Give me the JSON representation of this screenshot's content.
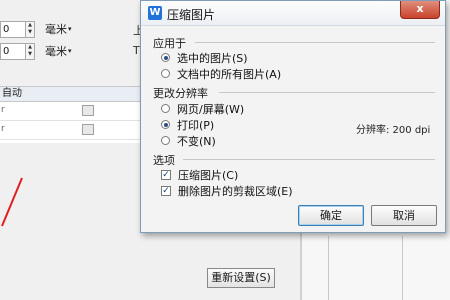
{
  "background": {
    "spin1": {
      "value": "0",
      "unit": "毫米"
    },
    "spin2": {
      "value": "0",
      "unit": "毫米"
    },
    "right_label_1": "上",
    "right_label_2": "T",
    "table_header": "自动",
    "row1_mark": "r",
    "row2_mark": "r",
    "reset_button": "重新设置(S)"
  },
  "dialog": {
    "title": "压缩图片",
    "app_icon_letter": "W",
    "close_symbol": "x",
    "apply_to": {
      "title": "应用于",
      "options": [
        {
          "label": "选中的图片(S)",
          "selected": true
        },
        {
          "label": "文档中的所有图片(A)",
          "selected": false
        }
      ]
    },
    "resolution": {
      "title": "更改分辨率",
      "options": [
        {
          "label": "网页/屏幕(W)",
          "selected": false
        },
        {
          "label": "打印(P)",
          "selected": true
        },
        {
          "label": "不变(N)",
          "selected": false
        }
      ],
      "dpi_text": "分辨率: 200 dpi"
    },
    "options": {
      "title": "选项",
      "checkboxes": [
        {
          "label": "压缩图片(C)",
          "checked": true
        },
        {
          "label": "删除图片的剪裁区域(E)",
          "checked": true
        }
      ]
    },
    "ok_button": "确定",
    "cancel_button": "取消"
  }
}
